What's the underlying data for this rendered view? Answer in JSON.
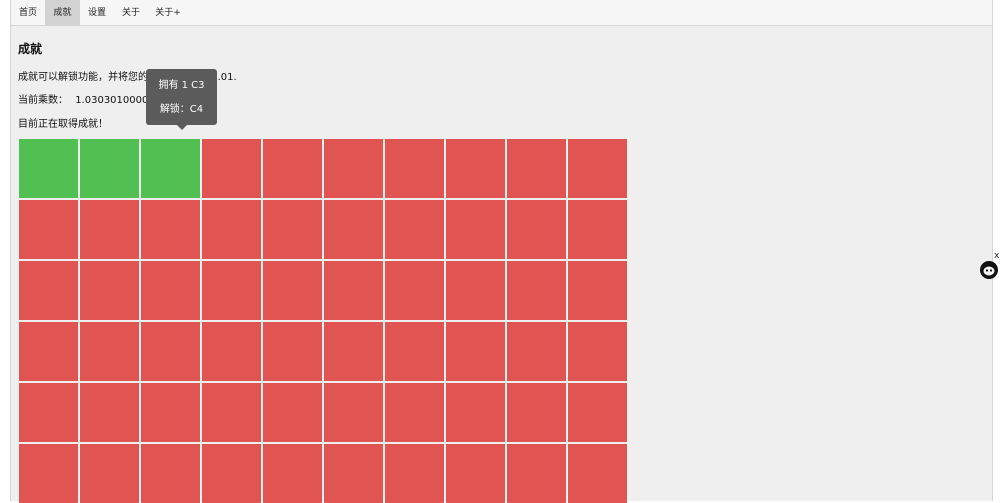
{
  "tabs": [
    {
      "label": "首页"
    },
    {
      "label": "成就"
    },
    {
      "label": "设置"
    },
    {
      "label": "关于"
    },
    {
      "label": "关于+"
    }
  ],
  "section": {
    "title": "成就",
    "description": "成就可以解锁功能，并将您的 DP 产量增加 1.01.",
    "multiplier_label": "当前乘数：",
    "multiplier_value": "1.0303010000",
    "status_text": "目前正在取得成就！"
  },
  "tooltip": {
    "line1": "拥有 1 C3",
    "line2": "解锁：C4"
  },
  "achievements": {
    "columns": 10,
    "visible_rows": 6,
    "completed_count": 3
  },
  "colors": {
    "completed": "#52bf52",
    "locked": "#e05452",
    "active_tab": "#d2d2d2"
  },
  "widget": {
    "close_label": "x",
    "icon": "octocat-icon"
  }
}
